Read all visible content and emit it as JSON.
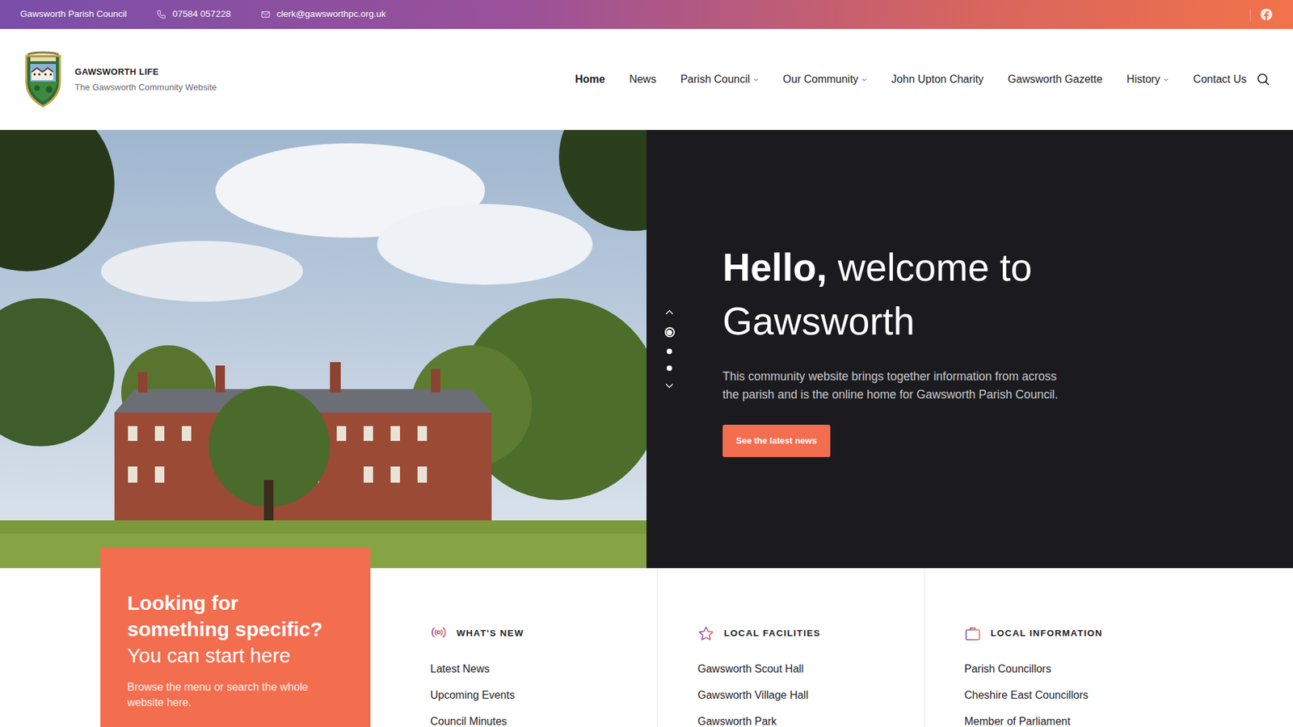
{
  "topbar": {
    "org": "Gawsworth Parish Council",
    "phone": "07584 057228",
    "email": "clerk@gawsworthpc.org.uk"
  },
  "brand": {
    "title": "GAWSWORTH LIFE",
    "tagline": "The Gawsworth Community Website"
  },
  "nav": [
    {
      "label": "Home",
      "selected": true,
      "dropdown": false
    },
    {
      "label": "News",
      "selected": false,
      "dropdown": false
    },
    {
      "label": "Parish Council",
      "selected": false,
      "dropdown": true
    },
    {
      "label": "Our Community",
      "selected": false,
      "dropdown": true
    },
    {
      "label": "John Upton Charity",
      "selected": false,
      "dropdown": false
    },
    {
      "label": "Gawsworth Gazette",
      "selected": false,
      "dropdown": false
    },
    {
      "label": "History",
      "selected": false,
      "dropdown": true
    },
    {
      "label": "Contact Us",
      "selected": false,
      "dropdown": false
    }
  ],
  "hero": {
    "heading_bold": "Hello,",
    "heading_rest": "welcome to Gawsworth",
    "text": "This community website brings together information from across the parish and is the online home for Gawsworth Parish Council.",
    "button": "See the latest news",
    "slides": [
      {
        "selected": true
      },
      {
        "selected": false
      },
      {
        "selected": false
      }
    ]
  },
  "search_box": {
    "title": "Looking for something specific?",
    "subtitle": "You can start here",
    "text": "Browse the menu or search the whole website here."
  },
  "columns": [
    {
      "kind": "broadcast",
      "title": "WHAT'S NEW",
      "links": [
        "Latest News",
        "Upcoming Events",
        "Council Minutes"
      ]
    },
    {
      "kind": "star",
      "title": "LOCAL FACILITIES",
      "links": [
        "Gawsworth Scout Hall",
        "Gawsworth Village Hall",
        "Gawsworth Park"
      ]
    },
    {
      "kind": "briefcase",
      "title": "LOCAL INFORMATION",
      "links": [
        "Parish Councillors",
        "Cheshire East Councillors",
        "Member of Parliament"
      ]
    }
  ]
}
